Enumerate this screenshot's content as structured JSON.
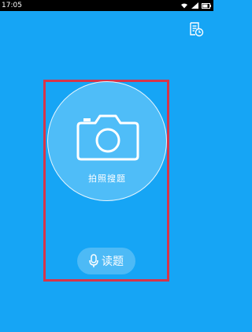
{
  "status_bar": {
    "time": "17:05",
    "icons": [
      "wifi-icon",
      "signal-icon",
      "battery-icon"
    ]
  },
  "toolbar": {
    "history_icon": "history-list-icon"
  },
  "main": {
    "camera_label": "拍照搜题",
    "camera_icon": "camera-icon",
    "read_button_label": "读题",
    "read_button_icon": "microphone-icon"
  },
  "colors": {
    "background": "#16a5f5",
    "circle": "#4fbdf8",
    "highlight": "#d6354a"
  }
}
